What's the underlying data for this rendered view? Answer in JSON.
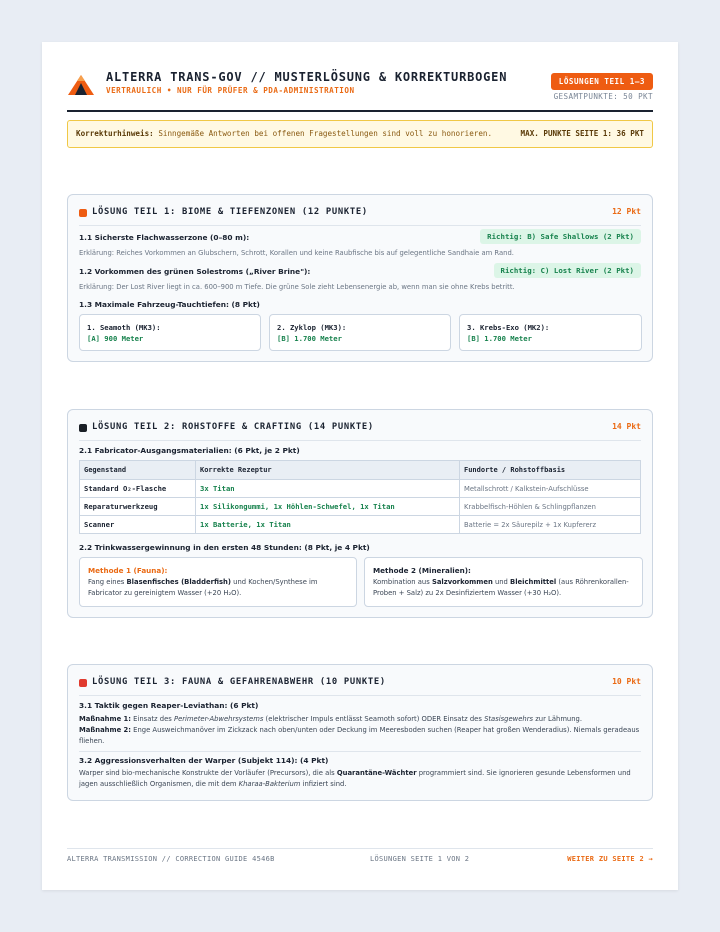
{
  "header": {
    "title": "ALTERRA TRANS-GOV // MUSTERLÖSUNG & KORREKTURBOGEN",
    "subtitle": "VERTRAULICH • NUR FÜR PRÜFER & PDA-ADMINISTRATION",
    "badge": "LÖSUNGEN TEIL 1–3",
    "total": "GESAMTPUNKTE: 50 PKT",
    "logo_icon": "alterra-logo-icon"
  },
  "notice": {
    "label": "Korrekturhinweis:",
    "text": "Sinngemäße Antworten bei offenen Fragestellungen sind voll zu honorieren.",
    "points": "MAX. PUNKTE SEITE 1: 36 PKT"
  },
  "colors": {
    "accent": "#ea6a14",
    "correct": "#17824d",
    "section1": "#ee5c12",
    "section2": "#1a1f26",
    "section3": "#e03a2e"
  },
  "s1": {
    "title": "LÖSUNG TEIL 1: BIOME & TIEFENZONEN (12 PUNKTE)",
    "points": "12 Pkt",
    "q1": "1.1 Sicherste Flachwasserzone (0–80 m):",
    "a1": "Richtig: B) Safe Shallows (2 Pkt)",
    "e1": "Erklärung: Reiches Vorkommen an Glubschern, Schrott, Korallen und keine Raubfische bis auf gelegentliche Sandhaie am Rand.",
    "q2": "1.2 Vorkommen des grünen Solestroms („River Brine\"):",
    "a2": "Richtig: C) Lost River (2 Pkt)",
    "e2": "Erklärung: Der Lost River liegt in ca. 600–900 m Tiefe. Die grüne Sole zieht Lebensenergie ab, wenn man sie ohne Krebs betritt.",
    "q3": "1.3 Maximale Fahrzeug-Tauchtiefen: (8 Pkt)",
    "cards": [
      {
        "title": "1. Seamoth (MK3):",
        "value": "[A] 900 Meter"
      },
      {
        "title": "2. Zyklop (MK3):",
        "value": "[B] 1.700 Meter"
      },
      {
        "title": "3. Krebs-Exo (MK2):",
        "value": "[B] 1.700 Meter"
      }
    ]
  },
  "s2": {
    "title": "LÖSUNG TEIL 2: ROHSTOFFE & CRAFTING (14 PUNKTE)",
    "points": "14 Pkt",
    "q1": "2.1 Fabricator-Ausgangsmaterialien: (6 Pkt, je 2 Pkt)",
    "headers": [
      "Gegenstand",
      "Korrekte Rezeptur",
      "Fundorte / Rohstoffbasis"
    ],
    "rows": [
      {
        "item": "Standard O₂-Flasche",
        "recipe": "3x Titan",
        "source": "Metallschrott / Kalkstein-Aufschlüsse"
      },
      {
        "item": "Reparaturwerkzeug",
        "recipe": "1x Silikongummi, 1x Höhlen-Schwefel, 1x Titan",
        "source": "Krabbelfisch-Höhlen & Schlingpflanzen"
      },
      {
        "item": "Scanner",
        "recipe": "1x Batterie, 1x Titan",
        "source": "Batterie = 2x Säurepilz + 1x Kupfererz"
      }
    ],
    "q2": "2.2 Trinkwassergewinnung in den ersten 48 Stunden: (8 Pkt, je 4 Pkt)",
    "m1_title": "Methode 1 (Fauna):",
    "m1_a": "Fang eines ",
    "m1_b": "Blasenfisches (Bladderfish)",
    "m1_c": " und Kochen/Synthese im Fabricator zu gereinigtem Wasser (+20 H₂O).",
    "m2_title": "Methode 2 (Mineralien):",
    "m2_a": "Kombination aus ",
    "m2_b": "Salzvorkommen",
    "m2_c": " und ",
    "m2_d": "Bleichmittel",
    "m2_e": " (aus Röhrenkorallen-Proben + Salz) zu 2x Desinfiziertem Wasser (+30 H₂O)."
  },
  "s3": {
    "title": "LÖSUNG TEIL 3: FAUNA & GEFAHRENABWEHR (10 PUNKTE)",
    "points": "10 Pkt",
    "q1": "3.1 Taktik gegen Reaper-Leviathan: (6 Pkt)",
    "m1_label": "Maßnahme 1:",
    "m1_a": " Einsatz des ",
    "m1_i": "Perimeter-Abwehrsystems",
    "m1_b": " (elektrischer Impuls entlässt Seamoth sofort) ODER Einsatz des ",
    "m1_i2": "Stasisgewehrs",
    "m1_c": " zur Lähmung.",
    "m2_label": "Maßnahme 2:",
    "m2_text": " Enge Ausweichmanöver im Zickzack nach oben/unten oder Deckung im Meeresboden suchen (Reaper hat großen Wenderadius). Niemals geradeaus fliehen.",
    "q2": "3.2 Aggressionsverhalten der Warper (Subjekt 114): (4 Pkt)",
    "p2_a": "Warper sind bio-mechanische Konstrukte der Vorläufer (Precursors), die als ",
    "p2_b": "Quarantäne-Wächter",
    "p2_c": " programmiert sind. Sie ignorieren gesunde Lebensformen und jagen ausschließlich Organismen, die mit dem ",
    "p2_i": "Kharaa-Bakterium",
    "p2_d": " infiziert sind."
  },
  "footer": {
    "left": "ALTERRA TRANSMISSION // CORRECTION GUIDE 4546B",
    "center": "LÖSUNGEN SEITE 1 VON 2",
    "next": "WEITER ZU SEITE 2 →"
  }
}
